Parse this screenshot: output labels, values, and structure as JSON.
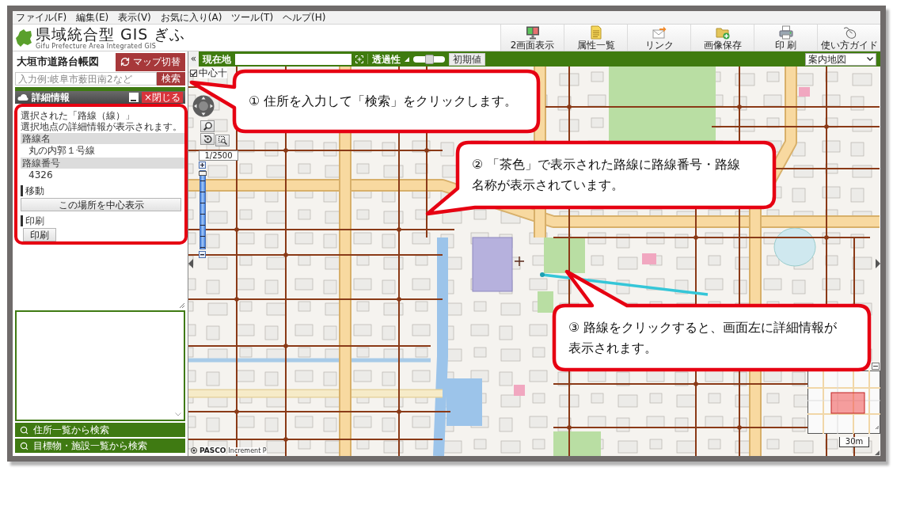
{
  "menu_bar": [
    "ファイル(F)",
    "編集(E)",
    "表示(V)",
    "お気に入り(A)",
    "ツール(T)",
    "ヘルプ(H)"
  ],
  "header": {
    "title": "県域統合型 GIS ぎふ",
    "subtitle": "Gifu Prefecture Area Integrated GIS",
    "tools": [
      {
        "kind": "dual_screen",
        "label": "2画面表示"
      },
      {
        "kind": "attributes",
        "label": "属性一覧"
      },
      {
        "kind": "link",
        "label": "リンク"
      },
      {
        "kind": "save_image",
        "label": "画像保存"
      },
      {
        "kind": "print",
        "label": "印 刷"
      },
      {
        "kind": "guide",
        "label": "使い方ガイド"
      }
    ]
  },
  "sidebar": {
    "title": "大垣市道路台帳図",
    "switch_button": "マップ切替",
    "search": {
      "placeholder": "入力例:岐阜市薮田南2など",
      "button": "検索"
    },
    "detail_panel": {
      "title": "詳細情報",
      "close_button": "×閉じる",
      "intro": [
        "選択された「路線（線）」",
        "選択地点の詳細情報が表示されます。"
      ],
      "fields": [
        {
          "label": "路線名",
          "value": "丸の内郭１号線"
        },
        {
          "label": "路線番号",
          "value": "4326"
        }
      ],
      "sections": [
        {
          "kind": "wide",
          "heading": "移動",
          "button": "この場所を中心表示"
        },
        {
          "kind": "compact",
          "heading": "印刷",
          "button": "印刷"
        }
      ]
    },
    "search_links": [
      "住所一覧から検索",
      "目標物・施設一覧から検索"
    ]
  },
  "map": {
    "toolbar": {
      "collapse_button": "«",
      "location_label": "現在地",
      "transparency_label": "透過性",
      "transparency": {
        "level": 0.5
      },
      "reset_button": "初期値",
      "basemap": "案内地図"
    },
    "center_cross": {
      "label": "中心十",
      "checked": true
    },
    "scale": "1/2500",
    "zoom": {
      "level": 1
    },
    "scale_bar": "30m",
    "credit": {
      "brand": "PASCO",
      "provider": "Increment P"
    }
  },
  "callouts": [
    {
      "text": "① 住所を入力して「検索」をクリックします。"
    },
    {
      "text": "② 「茶色」で表示された路線に路線番号・路線名称が表示されています。"
    },
    {
      "text": "③ 路線をクリックすると、画面左に詳細情報が表示されます。"
    }
  ]
}
